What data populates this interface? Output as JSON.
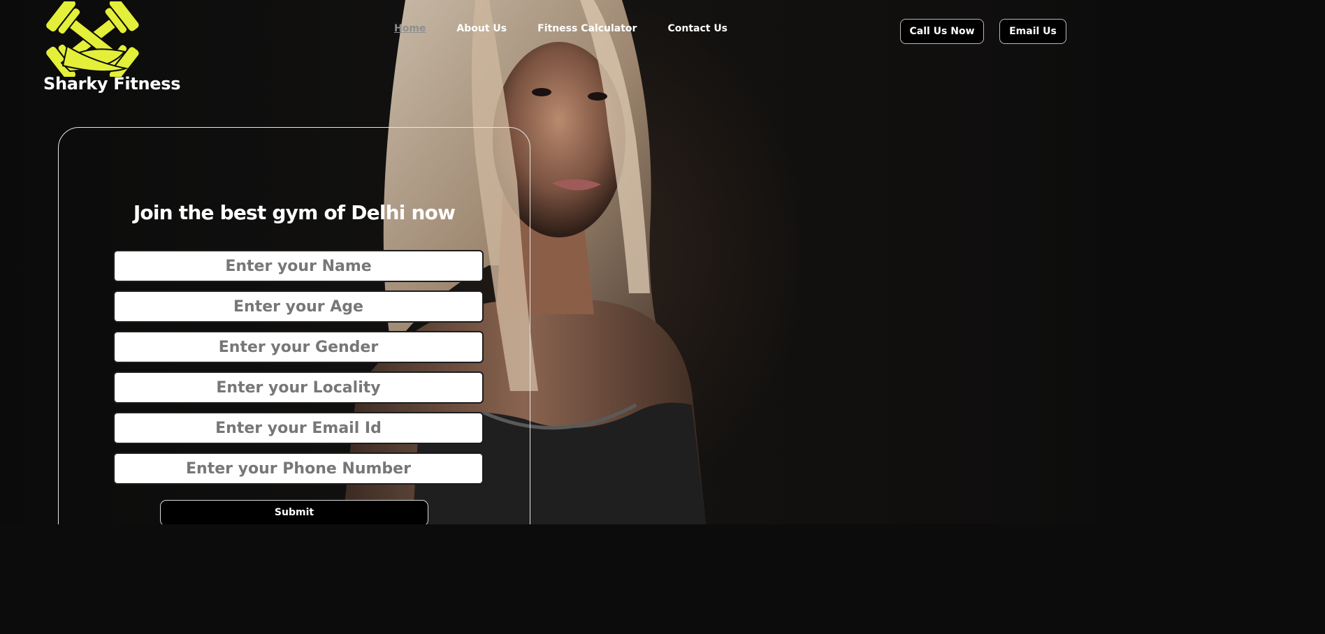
{
  "brand": {
    "name": "Sharky Fitness",
    "logo_icon": "crossed-dumbbells-icon",
    "accent_color": "#e3ef38"
  },
  "nav": {
    "items": [
      {
        "label": "Home",
        "active": true
      },
      {
        "label": "About Us",
        "active": false
      },
      {
        "label": "Fitness Calculator",
        "active": false
      },
      {
        "label": "Contact Us",
        "active": false
      }
    ]
  },
  "header_actions": {
    "call_label": "Call Us Now",
    "email_label": "Email Us"
  },
  "form": {
    "title": "Join the best gym of Delhi now",
    "fields": [
      {
        "placeholder": "Enter your Name",
        "value": ""
      },
      {
        "placeholder": "Enter your Age",
        "value": ""
      },
      {
        "placeholder": "Enter your Gender",
        "value": ""
      },
      {
        "placeholder": "Enter your Locality",
        "value": ""
      },
      {
        "placeholder": "Enter your Email Id",
        "value": ""
      },
      {
        "placeholder": "Enter your Phone Number",
        "value": ""
      }
    ],
    "submit_label": "Submit"
  },
  "colors": {
    "background": "#0d0c0c",
    "nav_active": "#8e8e8e",
    "button_bg": "#000000",
    "text": "#ffffff"
  }
}
